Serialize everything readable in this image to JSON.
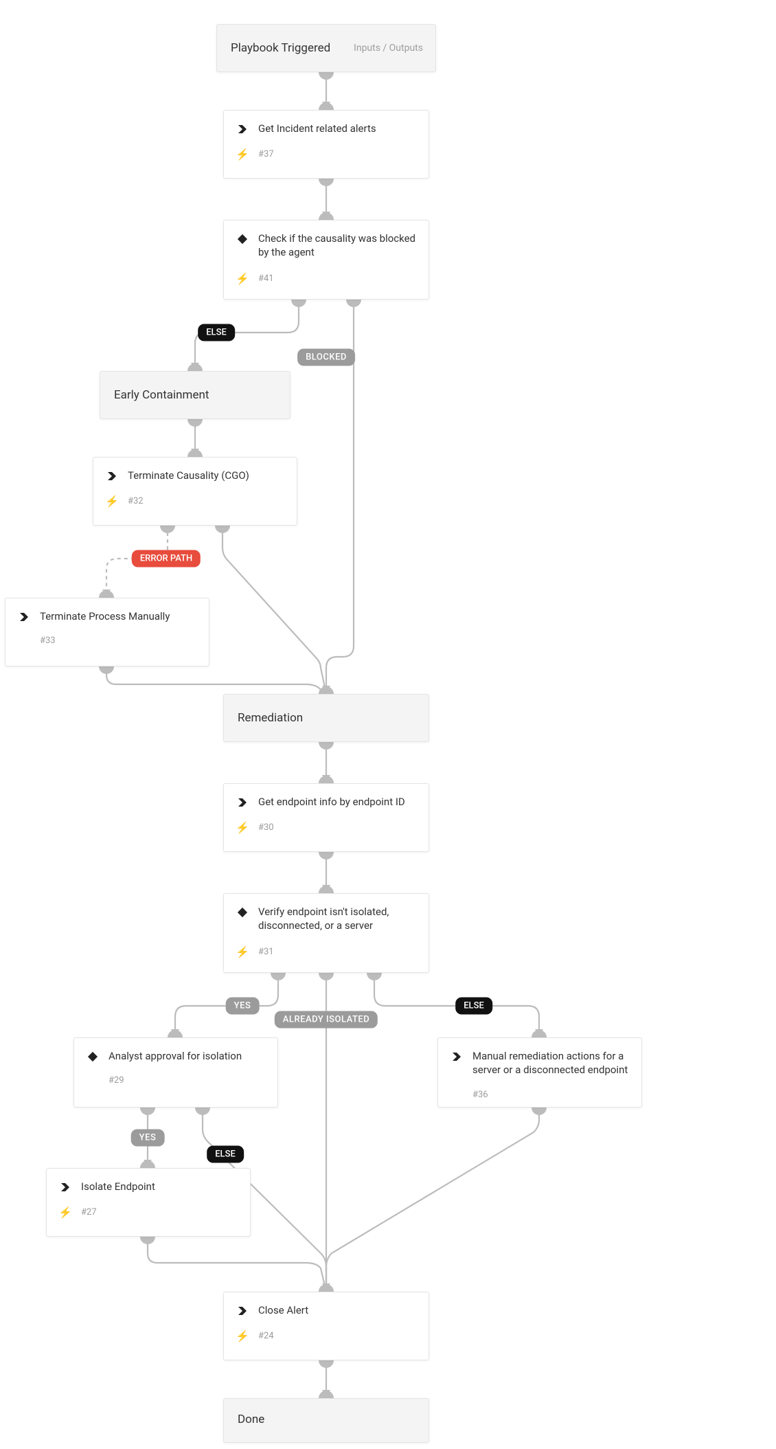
{
  "nodes": {
    "start": {
      "title": "Playbook Triggered",
      "io": "Inputs / Outputs"
    },
    "n37": {
      "label": "Get Incident related alerts",
      "num": "#37",
      "icon": "chevron",
      "bolt": true
    },
    "n41": {
      "label": "Check if the causality was blocked by the agent",
      "num": "#41",
      "icon": "diamond",
      "bolt": true
    },
    "early": {
      "title": "Early Containment"
    },
    "n32": {
      "label": "Terminate Causality (CGO)",
      "num": "#32",
      "icon": "chevron",
      "bolt": true
    },
    "n33": {
      "label": "Terminate Process Manually",
      "num": "#33",
      "icon": "chevron",
      "bolt": false
    },
    "remed": {
      "title": "Remediation"
    },
    "n30": {
      "label": "Get endpoint info by endpoint ID",
      "num": "#30",
      "icon": "chevron",
      "bolt": true
    },
    "n31": {
      "label": "Verify endpoint isn't isolated, disconnected, or a server",
      "num": "#31",
      "icon": "diamond",
      "bolt": true
    },
    "n29": {
      "label": "Analyst approval for isolation",
      "num": "#29",
      "icon": "diamond",
      "bolt": false
    },
    "n36": {
      "label": "Manual remediation actions for a server or a disconnected endpoint",
      "num": "#36",
      "icon": "chevron",
      "bolt": false
    },
    "n27": {
      "label": "Isolate Endpoint",
      "num": "#27",
      "icon": "chevron",
      "bolt": true
    },
    "n24": {
      "label": "Close Alert",
      "num": "#24",
      "icon": "chevron",
      "bolt": true
    },
    "done": {
      "title": "Done"
    }
  },
  "pills": {
    "else41": "ELSE",
    "blocked": "BLOCKED",
    "errpath": "ERROR PATH",
    "yes31": "YES",
    "already": "ALREADY ISOLATED",
    "else31": "ELSE",
    "yes29": "YES",
    "else29": "ELSE"
  }
}
